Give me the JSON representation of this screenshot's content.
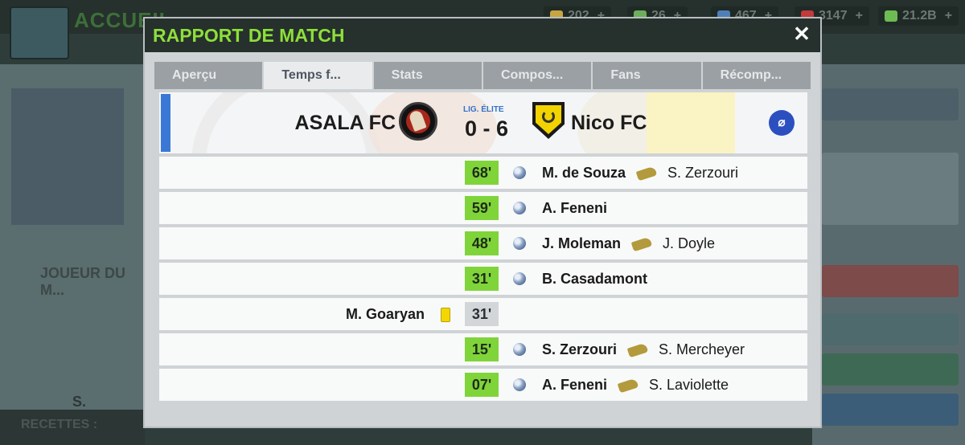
{
  "background": {
    "title": "ACCUEIL",
    "stats": [
      {
        "label": "202",
        "color": "#c7a642"
      },
      {
        "label": "26",
        "color": "#6dae5a"
      },
      {
        "label": "467",
        "color": "#4f7fb8"
      },
      {
        "label": "3147",
        "color": "#c23a3a"
      },
      {
        "label": "21.2B",
        "color": "#6dbb52"
      }
    ],
    "plus_glyph": "+",
    "left_label": "JOUEUR DU M...",
    "left_player": "S. Merchey...",
    "bottom_label": "RECETTES :"
  },
  "modal": {
    "title": "RAPPORT DE MATCH",
    "close_glyph": "✕",
    "tabs": [
      {
        "label": "Aperçu",
        "active": false
      },
      {
        "label": "Temps f...",
        "active": true
      },
      {
        "label": "Stats",
        "active": false
      },
      {
        "label": "Compos...",
        "active": false
      },
      {
        "label": "Fans",
        "active": false
      },
      {
        "label": "Récomp...",
        "active": false
      }
    ],
    "match": {
      "home_team": "ASALA FC",
      "away_team": "Nico FC",
      "league": "LIG. ÉLITE",
      "score": "0 - 6",
      "home_crest_icon": "spartan-helmet-crest-icon",
      "away_crest_icon": "laurel-shield-crest-icon",
      "weather_icon": "weather-icon",
      "weather_glyph": "⌀"
    },
    "events": [
      {
        "minute": "68'",
        "side": "away",
        "type": "goal",
        "scorer": "M. de Souza",
        "assist": "S. Zerzouri"
      },
      {
        "minute": "59'",
        "side": "away",
        "type": "goal",
        "scorer": "A. Feneni",
        "assist": ""
      },
      {
        "minute": "48'",
        "side": "away",
        "type": "goal",
        "scorer": "J. Moleman",
        "assist": "J. Doyle"
      },
      {
        "minute": "31'",
        "side": "away",
        "type": "goal",
        "scorer": "B. Casadamont",
        "assist": ""
      },
      {
        "minute": "31'",
        "side": "home",
        "type": "yellow-card",
        "player": "M. Goaryan"
      },
      {
        "minute": "15'",
        "side": "away",
        "type": "goal",
        "scorer": "S. Zerzouri",
        "assist": "S. Mercheyer"
      },
      {
        "minute": "07'",
        "side": "away",
        "type": "goal",
        "scorer": "A. Feneni",
        "assist": "S. Laviolette"
      }
    ],
    "colors": {
      "title": "#8ddf3a",
      "minute_away": "#7fd43a",
      "minute_home": "#d3d6d9",
      "accent": "#3b78d6",
      "yellow_card": "#f4d700"
    }
  }
}
